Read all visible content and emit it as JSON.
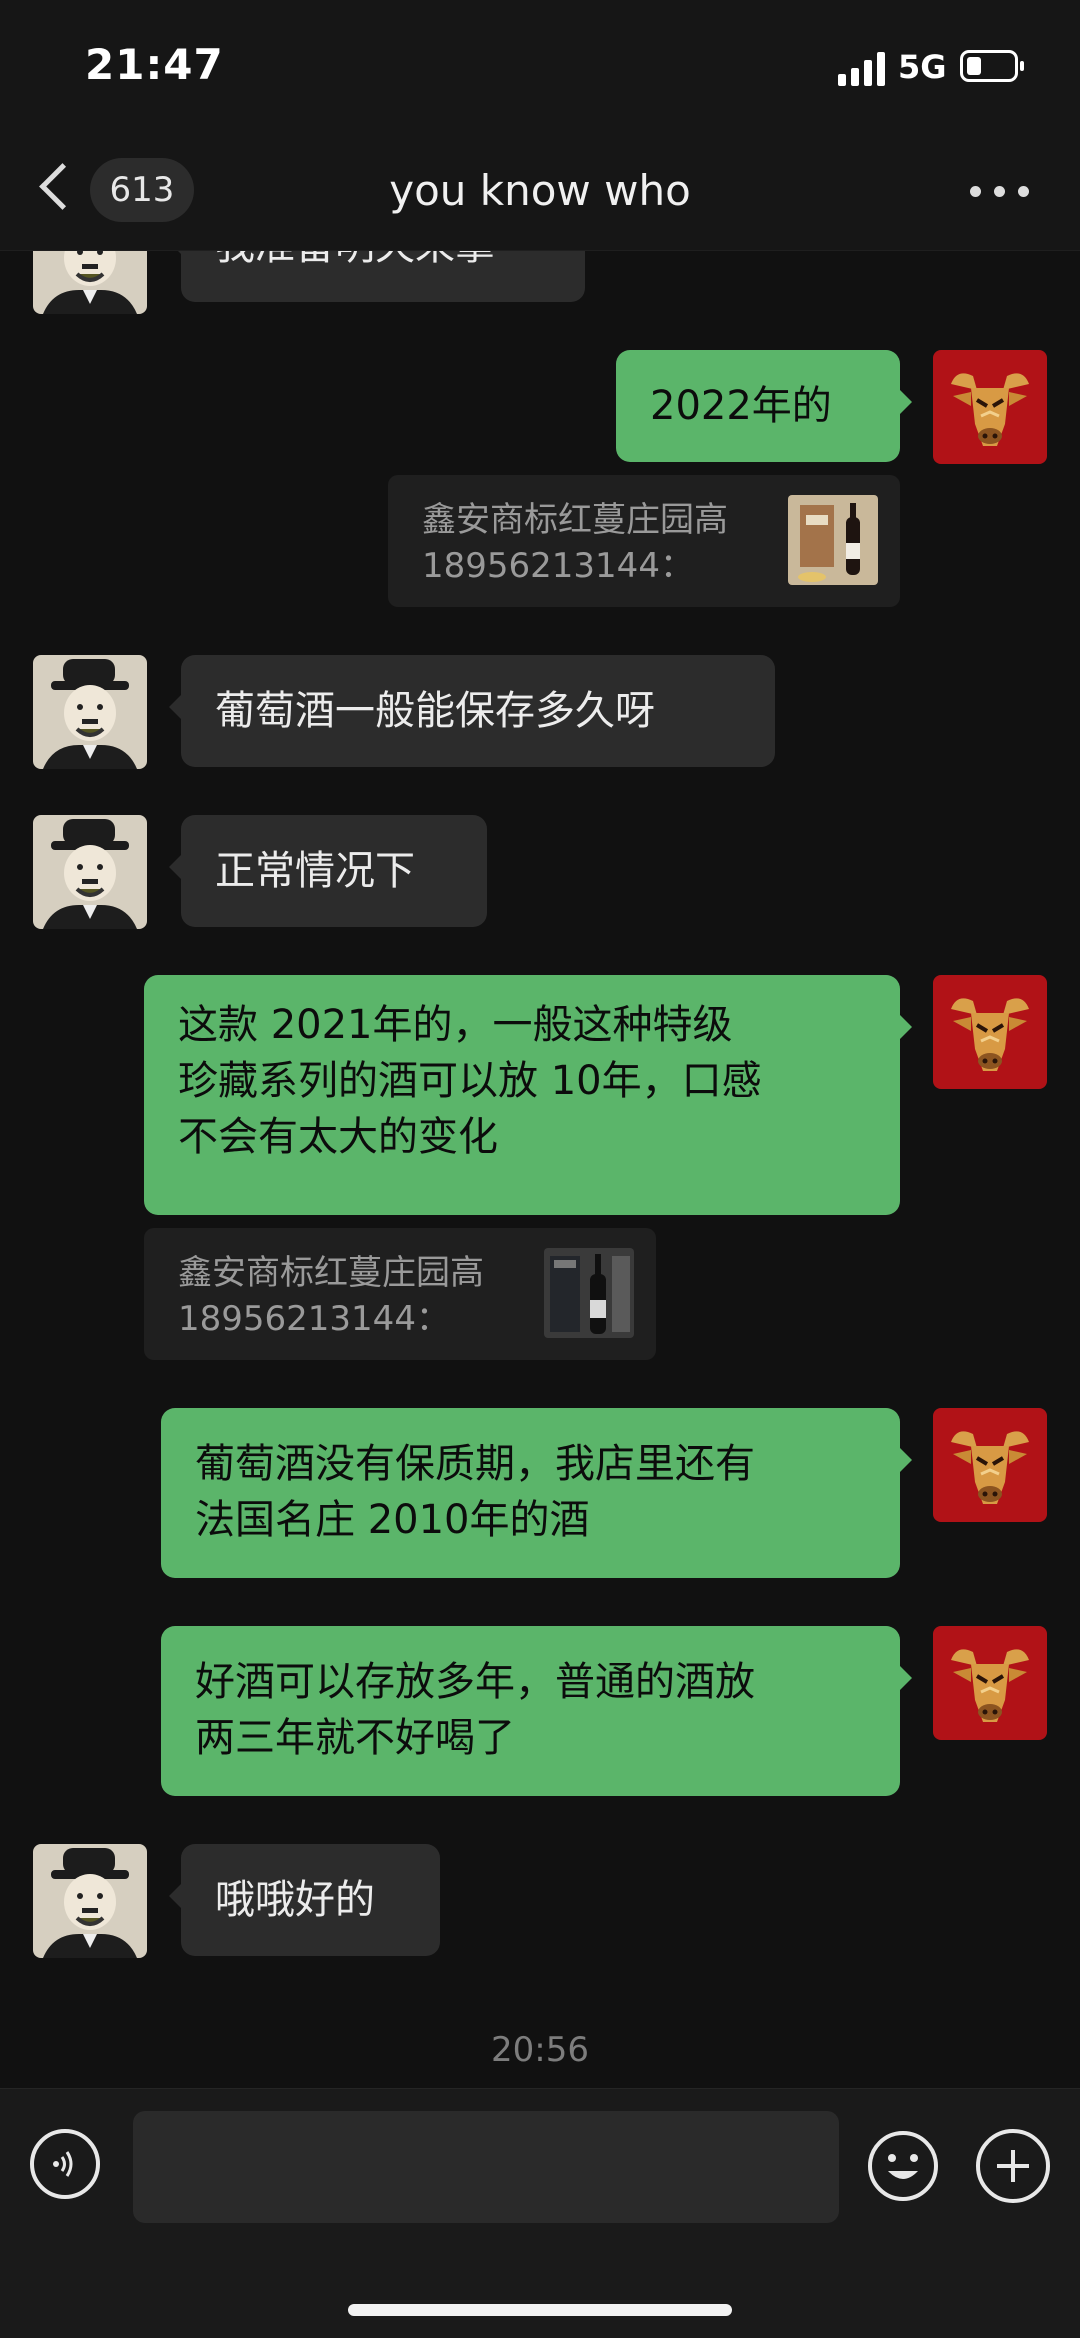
{
  "status": {
    "time": "21:47",
    "network": "5G"
  },
  "header": {
    "unread": "613",
    "title": "you know who",
    "more_icon": "more-icon"
  },
  "partial_top": {
    "text": "我准备明天来拿"
  },
  "messages": [
    {
      "from": "me",
      "lines": [
        "2022年的"
      ]
    },
    {
      "from": "quote",
      "lines": [
        "鑫安商标红蔓庄园高",
        "18956213144："
      ]
    },
    {
      "from": "them",
      "lines": [
        "葡萄酒一般能保存多久呀"
      ]
    },
    {
      "from": "them",
      "lines": [
        "正常情况下"
      ]
    },
    {
      "from": "me",
      "lines": [
        "这款 2021年的，一般这种特级",
        "珍藏系列的酒可以放 10年，口感",
        "不会有太大的变化"
      ]
    },
    {
      "from": "quote",
      "lines": [
        "鑫安商标红蔓庄园高",
        "18956213144："
      ]
    },
    {
      "from": "me",
      "lines": [
        "葡萄酒没有保质期，我店里还有",
        "法国名庄 2010年的酒"
      ]
    },
    {
      "from": "me",
      "lines": [
        "好酒可以存放多年，普通的酒放",
        "两三年就不好喝了"
      ]
    },
    {
      "from": "them",
      "lines": [
        "哦哦好的"
      ]
    }
  ],
  "timestamp": "20:56",
  "input": {
    "placeholder": ""
  },
  "colors": {
    "bg": "#111111",
    "bubble_in": "#2c2c2c",
    "bubble_out": "#5bb56a",
    "quote_bg": "#1f1f1f",
    "avatar_me": "#b4161b"
  }
}
